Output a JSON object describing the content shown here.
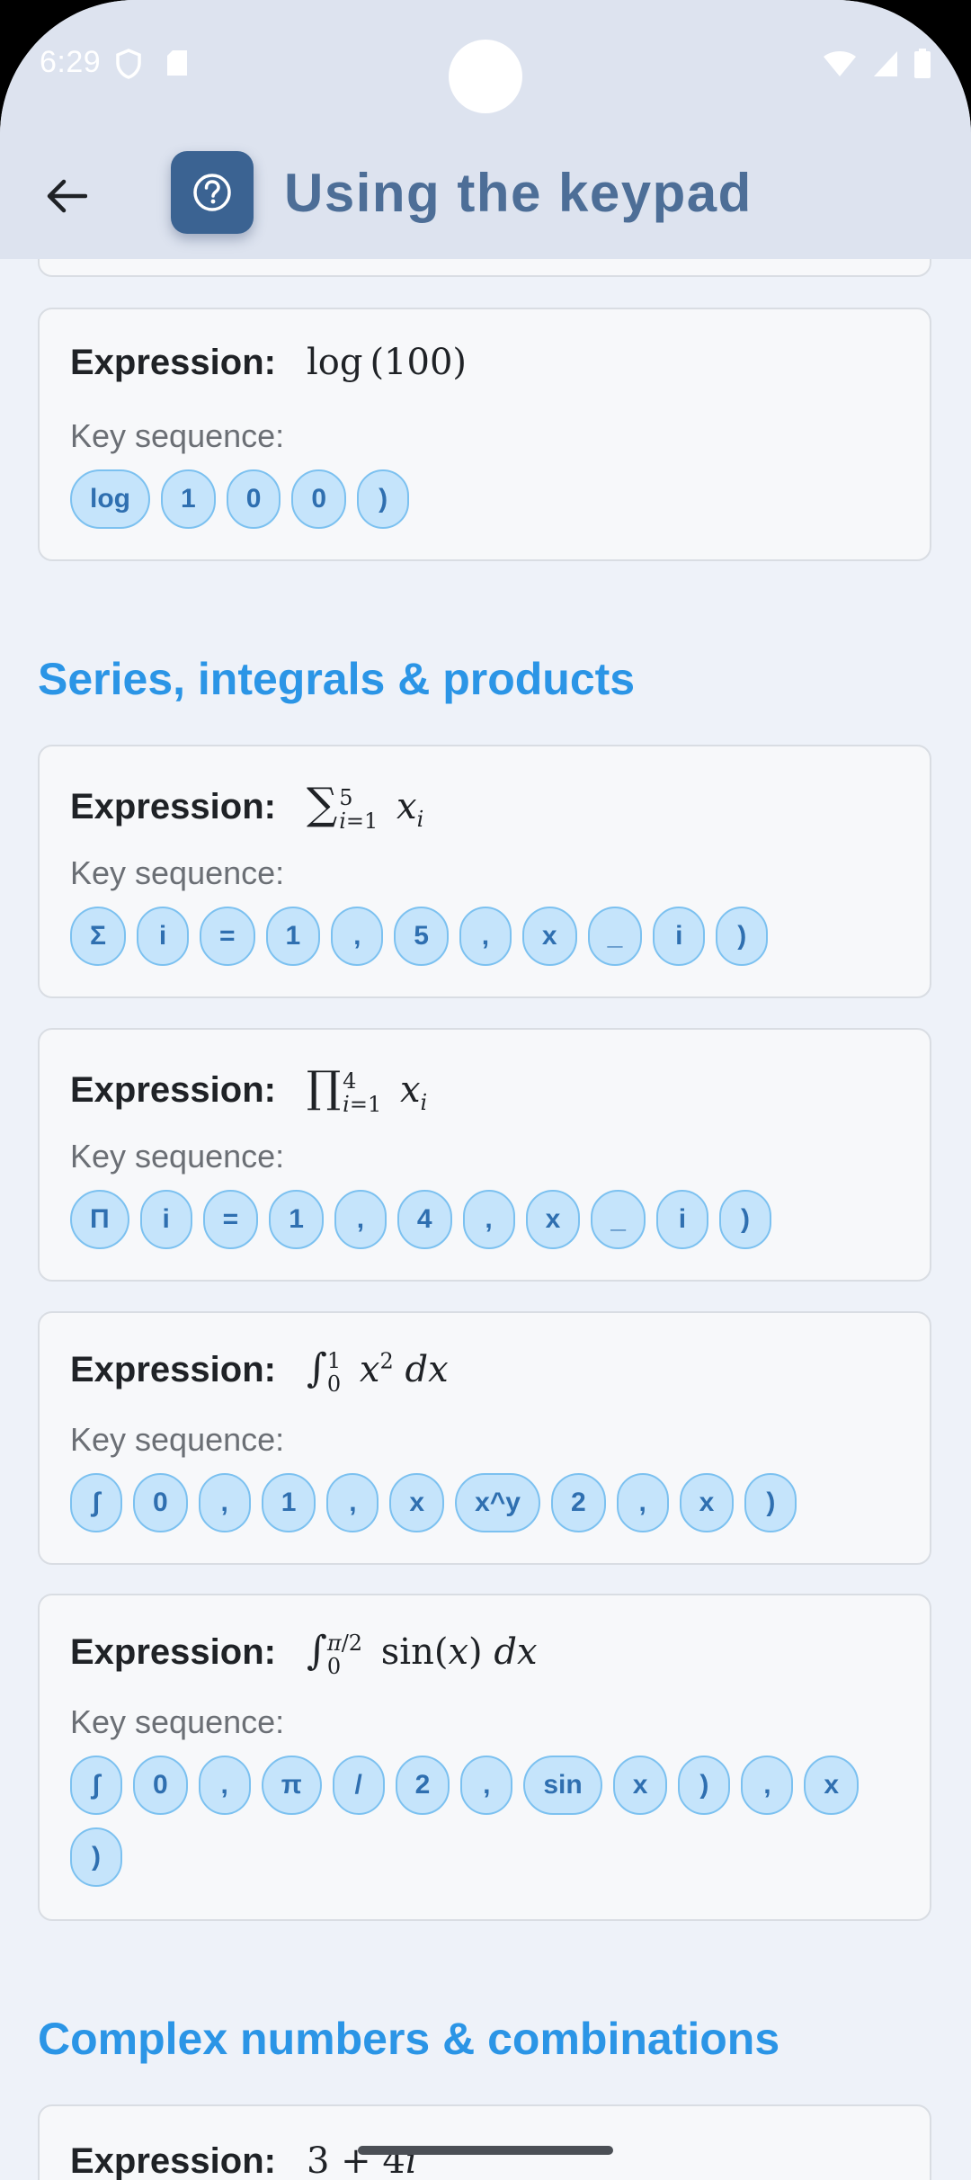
{
  "status": {
    "time": "6:29"
  },
  "appbar": {
    "title": "Using the keypad"
  },
  "labels": {
    "expression": "Expression:",
    "key_sequence": "Key sequence:"
  },
  "sections": {
    "series": "Series, integrals & products",
    "complex": "Complex numbers & combinations"
  },
  "cards": [
    {
      "expr_html": "log(100)",
      "keys": [
        "log",
        "1",
        "0",
        "0",
        ")"
      ]
    },
    {
      "expr_html": "∑<sup>5</sup><sub>i=1</sub> x<sub>i</sub>",
      "keys": [
        "Σ",
        "i",
        "=",
        "1",
        ",",
        "5",
        ",",
        "x",
        "_",
        "i",
        ")"
      ]
    },
    {
      "expr_html": "∏<sup>4</sup><sub>i=1</sub> x<sub>i</sub>",
      "keys": [
        "Π",
        "i",
        "=",
        "1",
        ",",
        "4",
        ",",
        "x",
        "_",
        "i",
        ")"
      ]
    },
    {
      "expr_html": "∫<sup>1</sup><sub>0</sub> x<sup>2</sup> dx",
      "keys": [
        "∫",
        "0",
        ",",
        "1",
        ",",
        "x",
        "x^y",
        "2",
        ",",
        "x",
        ")"
      ]
    },
    {
      "expr_html": "∫<sup>π/2</sup><sub>0</sub> sin(x) dx",
      "keys": [
        "∫",
        "0",
        ",",
        "π",
        "/",
        "2",
        ",",
        "sin",
        "x",
        ")",
        ",",
        "x",
        ")"
      ]
    },
    {
      "expr_html": "3 + 4i",
      "keys": []
    }
  ],
  "icons": {
    "back": "arrow-back-icon",
    "help": "help-circle-icon"
  },
  "colors": {
    "accent": "#2b95e6",
    "key_fill": "#c5e4fb",
    "key_border": "#7cc1f0",
    "key_text": "#2f6fb0",
    "appbar": "#dde3ef",
    "title": "#4d6e97"
  }
}
